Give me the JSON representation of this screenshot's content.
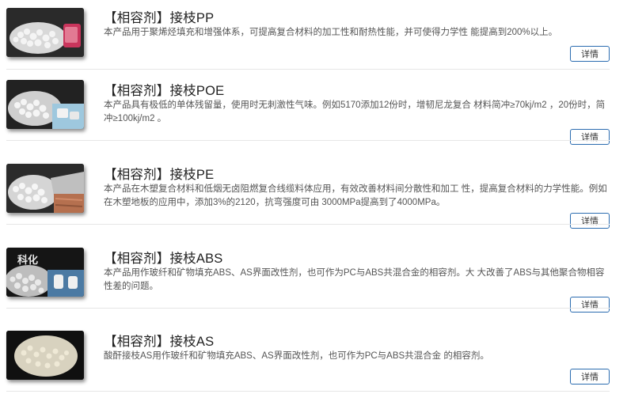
{
  "products": [
    {
      "title": "【相容剂】接枝PP",
      "desc": "本产品用于聚烯烃填充和增强体系，可提高复合材料的加工性和耐热性能，并可使得力学性 能提高到200%以上。",
      "button": "详情",
      "image_icon": "pellets-image"
    },
    {
      "title": "【相容剂】接枝POE",
      "desc": "本产品具有极低的单体残留量，使用时无刺激性气味。例如5170添加12份时，增韧尼龙复合 材料简冲≥70kj/m2 ，20份时，简冲≥100kj/m2 。",
      "button": "详情",
      "image_icon": "pellets-image"
    },
    {
      "title": "【相容剂】接枝PE",
      "desc": "本产品在木塑复合材料和低烟无卤阻燃复合线缆料体应用，有效改善材料间分散性和加工 性，提高复合材料的力学性能。例如在木塑地板的应用中，添加3%的2120，抗弯强度可由 3000MPa提高到了4000MPa。",
      "button": "详情",
      "image_icon": "pellets-image"
    },
    {
      "title": "【相容剂】接枝ABS",
      "desc": "本产品用作玻纤和矿物填充ABS、AS界面改性剂，也可作为PC与ABS共混合金的相容剂。大 大改善了ABS与其他聚合物相容性差的问题。",
      "button": "详情",
      "image_icon": "pellets-image",
      "image_caption": "科化"
    },
    {
      "title": "【相容剂】接枝AS",
      "desc": "酸酐接枝AS用作玻纤和矿物填充ABS、AS界面改性剂，也可作为PC与ABS共混合金 的相容剂。",
      "button": "详情",
      "image_icon": "pellets-image"
    }
  ],
  "colors": {
    "button_border": "#2b6cb0",
    "title": "#222222",
    "desc": "#555555",
    "divider": "#e6e6e6"
  }
}
